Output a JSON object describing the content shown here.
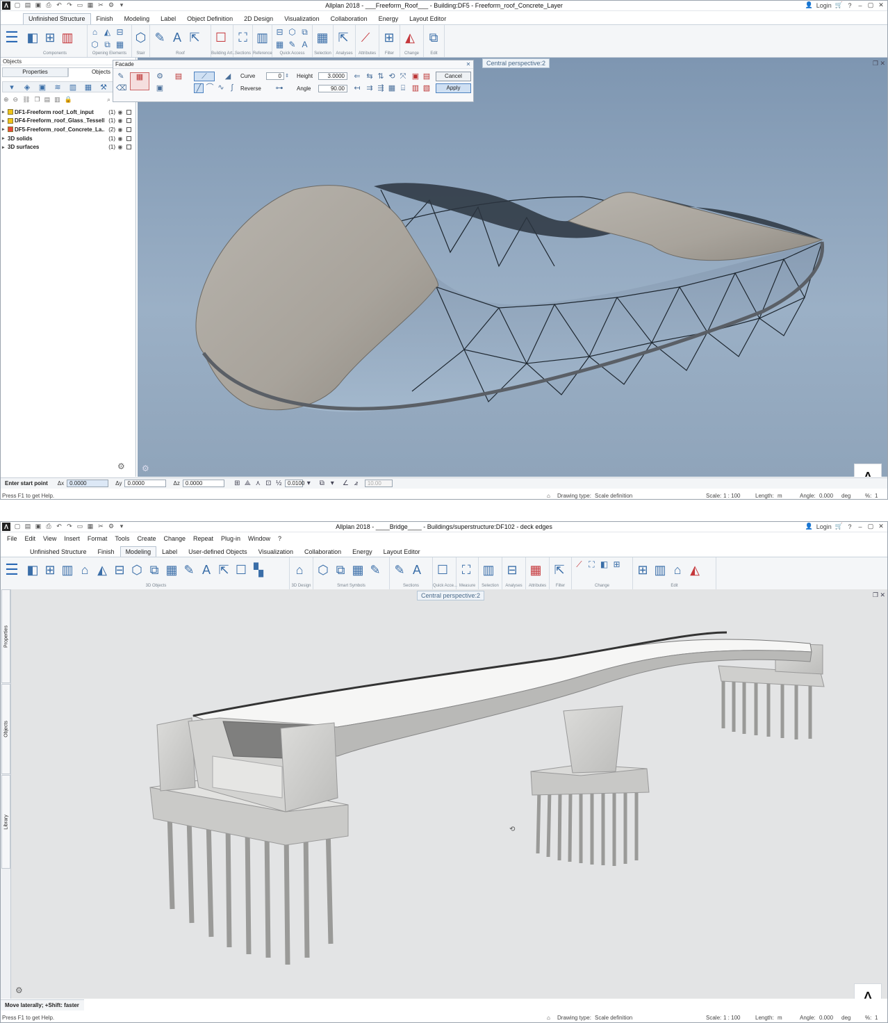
{
  "w1": {
    "title": "Allplan 2018 - ___Freeform_Roof___ - Building:DF5 - Freeform_roof_Concrete_Layer",
    "login": "Login",
    "tabs": [
      "Unfinished Structure",
      "Finish",
      "Modeling",
      "Label",
      "Object Definition",
      "2D Design",
      "Visualization",
      "Collaboration",
      "Energy",
      "Layout Editor"
    ],
    "groups": [
      "Components",
      "Opening Elements",
      "Stair",
      "Roof",
      "Building Art...",
      "Sections",
      "Reference",
      "Quick Access",
      "Selection",
      "Analyses",
      "Attributes",
      "Filter",
      "Change",
      "Edit"
    ],
    "objects_panel": {
      "header": "Objects",
      "tab_properties": "Properties",
      "tab_objects": "Objects",
      "tree": [
        {
          "label": "DF1-Freeform roof_Loft_input",
          "count": "(1)",
          "color": "#f0c419"
        },
        {
          "label": "DF4-Freeform_roof_Glass_Tessell...",
          "count": "(1)",
          "color": "#f0c419"
        },
        {
          "label": "DF5-Freeform_roof_Concrete_La...",
          "count": "(2)",
          "color": "#e84a3a"
        },
        {
          "label": "3D solids",
          "count": "(1)"
        },
        {
          "label": "3D surfaces",
          "count": "(1)"
        }
      ]
    },
    "facade": {
      "title": "Facade",
      "curve_label": "Curve",
      "curve_value": "0",
      "height_label": "Height",
      "height_value": "3.0000",
      "reverse_label": "Reverse",
      "angle_label": "Angle",
      "angle_value": "90.00",
      "cancel": "Cancel",
      "apply": "Apply"
    },
    "viewport_label": "Central perspective:2",
    "cmd": {
      "prompt": "Enter start point",
      "dx_label": "Δx",
      "dx": "0.0000",
      "dy_label": "Δy",
      "dy": "0.0000",
      "dz_label": "Δz",
      "dz": "0.0000",
      "snap": "0.0100",
      "angle_field": "10.00"
    },
    "status": {
      "help": "Press F1 to get Help.",
      "drawing_type_label": "Drawing type:",
      "drawing_type": "Scale definition",
      "scale_label": "Scale:",
      "scale": "1 : 100",
      "length_label": "Length:",
      "length": "m",
      "angle_label": "Angle:",
      "angle": "0.000",
      "angle_unit": "deg",
      "pct_label": "%:",
      "pct": "1"
    }
  },
  "w2": {
    "title": "Allplan 2018 - ____Bridge____ - Buildings/superstructure:DF102 - deck edges",
    "login": "Login",
    "menu": [
      "File",
      "Edit",
      "View",
      "Insert",
      "Format",
      "Tools",
      "Create",
      "Change",
      "Repeat",
      "Plug-in",
      "Window",
      "?"
    ],
    "tabs": [
      "Unfinished Structure",
      "Finish",
      "Modeling",
      "Label",
      "User-defined Objects",
      "Visualization",
      "Collaboration",
      "Energy",
      "Layout Editor"
    ],
    "groups": [
      "3D Objects",
      "3D Design",
      "Smart Symbols",
      "Sections",
      "Quick Acce...",
      "Measure",
      "Selection",
      "Analyses",
      "Attributes",
      "Filter",
      "Change",
      "Edit"
    ],
    "side_tabs": [
      "Properties",
      "Objects",
      "Library"
    ],
    "viewport_label": "Central perspective:2",
    "cmd": {
      "prompt": "Move laterally; +Shift: faster"
    },
    "status": {
      "help": "Press F1 to get Help.",
      "drawing_type_label": "Drawing type:",
      "drawing_type": "Scale definition",
      "scale_label": "Scale:",
      "scale": "1 : 100",
      "length_label": "Length:",
      "length": "m",
      "angle_label": "Angle:",
      "angle": "0.000",
      "angle_unit": "deg",
      "pct_label": "%:",
      "pct": "1"
    }
  },
  "colors": {
    "accent": "#2a68b4",
    "ribbon_group_bar": "#dbe5f0",
    "viewport1_sky": "#8fa4ba",
    "viewport2_bg": "#e3e4e5"
  }
}
